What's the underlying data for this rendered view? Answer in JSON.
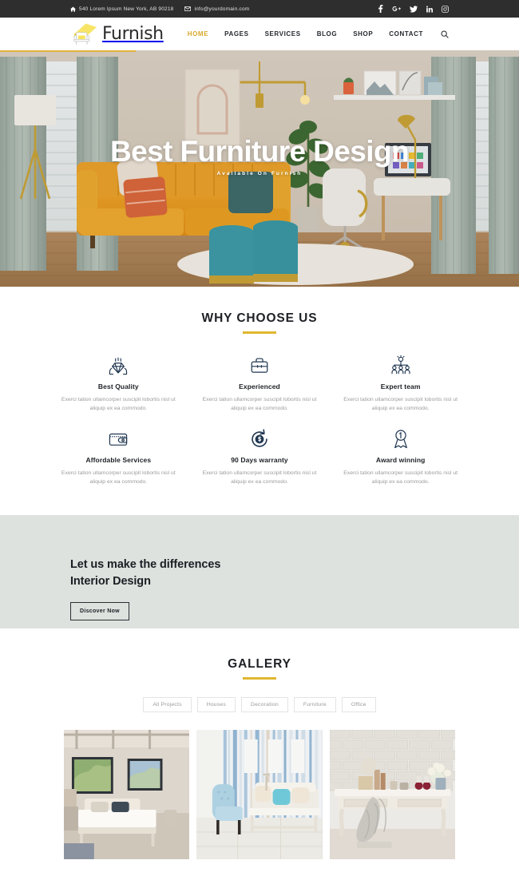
{
  "topbar": {
    "address": "540 Lorem Ipsum New York, AB 90218",
    "email": "info@yourdomain.com",
    "address_icon": "home-icon",
    "email_icon": "envelope-icon",
    "social": [
      {
        "name": "facebook-icon",
        "label": "f"
      },
      {
        "name": "google-plus-icon",
        "label": "G+"
      },
      {
        "name": "twitter-icon",
        "label": "t"
      },
      {
        "name": "linkedin-icon",
        "label": "in"
      },
      {
        "name": "instagram-icon",
        "label": "ig"
      }
    ]
  },
  "header": {
    "logo_text": "Furnish",
    "logo_icon": "armchair-logo-icon",
    "nav": [
      {
        "label": "HOME",
        "active": true
      },
      {
        "label": "PAGES",
        "active": false
      },
      {
        "label": "SERVICES",
        "active": false
      },
      {
        "label": "BLOG",
        "active": false
      },
      {
        "label": "SHOP",
        "active": false
      },
      {
        "label": "CONTACT",
        "active": false
      }
    ],
    "search_icon": "search-icon"
  },
  "hero": {
    "title": "Best Furniture Design",
    "subtitle": "Available On Furnish"
  },
  "why_choose_us": {
    "title": "WHY CHOOSE US",
    "features": [
      {
        "icon": "quality-hands-diamond-icon",
        "title": "Best Quality",
        "desc": "Exerci tation ullamcorper suscipit lobortis nisl ut aliquip ex ea commodo."
      },
      {
        "icon": "briefcase-icon",
        "title": "Experienced",
        "desc": "Exerci tation ullamcorper suscipit lobortis nisl ut aliquip ex ea commodo."
      },
      {
        "icon": "team-idea-icon",
        "title": "Expert team",
        "desc": "Exerci tation ullamcorper suscipit lobortis nisl ut aliquip ex ea commodo."
      },
      {
        "icon": "wallet-icon",
        "title": "Affordable Services",
        "desc": "Exerci tation ullamcorper suscipit lobortis nisl ut aliquip ex ea commodo."
      },
      {
        "icon": "money-back-icon",
        "title": "90 Days warranty",
        "desc": "Exerci tation ullamcorper suscipit lobortis nisl ut aliquip ex ea commodo."
      },
      {
        "icon": "award-ribbon-icon",
        "title": "Award winning",
        "desc": "Exerci tation ullamcorper suscipit lobortis nisl ut aliquip ex ea commodo."
      }
    ]
  },
  "cta": {
    "line1": "Let us make the differences",
    "line2": "Interior Design",
    "button": "Discover Now"
  },
  "gallery": {
    "title": "GALLERY",
    "filters": [
      "All Projects",
      "Houses",
      "Decoration",
      "Furniture",
      "Office"
    ],
    "active_filter": "All Projects",
    "items": [
      {
        "name": "gallery-image-bedroom",
        "alt": "Bedroom with beamed ceiling and large windows"
      },
      {
        "name": "gallery-image-living-room",
        "alt": "Living room with blue striped wallpaper and armchair"
      },
      {
        "name": "gallery-image-console-table",
        "alt": "White brick wall with console table and throw blanket"
      }
    ]
  },
  "colors": {
    "accent": "#d9a92b",
    "topbar_bg": "#2e2e2e",
    "cta_bg": "#dde2de",
    "dark_text": "#1d2025",
    "muted_text": "#9b9b9b"
  }
}
